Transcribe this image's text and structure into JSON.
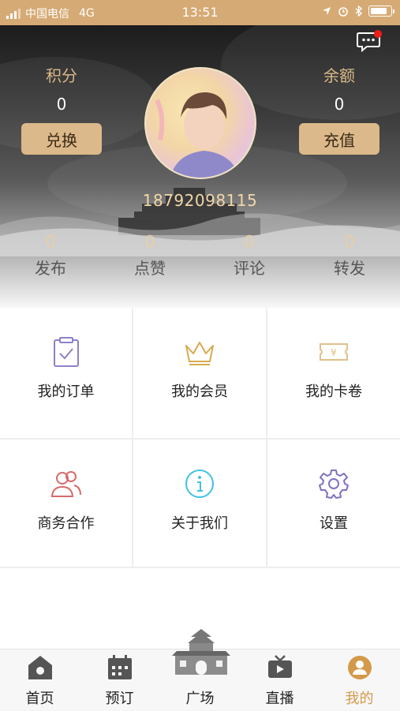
{
  "status_bar": {
    "carrier": "中国电信",
    "network": "4G",
    "time": "13:51",
    "battery_level": 0.85
  },
  "header": {
    "points": {
      "label": "积分",
      "value": "0",
      "button": "兑换"
    },
    "balance": {
      "label": "余额",
      "value": "0",
      "button": "充值"
    },
    "phone": "18792098115",
    "has_unread_message": true
  },
  "stats": [
    {
      "label": "发布",
      "value": "0"
    },
    {
      "label": "点赞",
      "value": "0"
    },
    {
      "label": "评论",
      "value": "0"
    },
    {
      "label": "转发",
      "value": "0"
    }
  ],
  "menu": [
    {
      "label": "我的订单",
      "icon": "clipboard-check-icon"
    },
    {
      "label": "我的会员",
      "icon": "crown-icon"
    },
    {
      "label": "我的卡卷",
      "icon": "coupon-icon"
    },
    {
      "label": "商务合作",
      "icon": "users-icon"
    },
    {
      "label": "关于我们",
      "icon": "info-icon"
    },
    {
      "label": "设置",
      "icon": "gear-icon"
    }
  ],
  "tabbar": [
    {
      "label": "首页",
      "icon": "home-icon",
      "active": false
    },
    {
      "label": "预订",
      "icon": "calendar-icon",
      "active": false
    },
    {
      "label": "广场",
      "icon": "plaza-building-icon",
      "active": false
    },
    {
      "label": "直播",
      "icon": "tv-icon",
      "active": false
    },
    {
      "label": "我的",
      "icon": "profile-icon",
      "active": true
    }
  ],
  "colors": {
    "status_bar": "#d6aa74",
    "gold_button": "#dcb98a",
    "accent": "#d49a4a",
    "unread_dot": "#ee1b1b"
  }
}
